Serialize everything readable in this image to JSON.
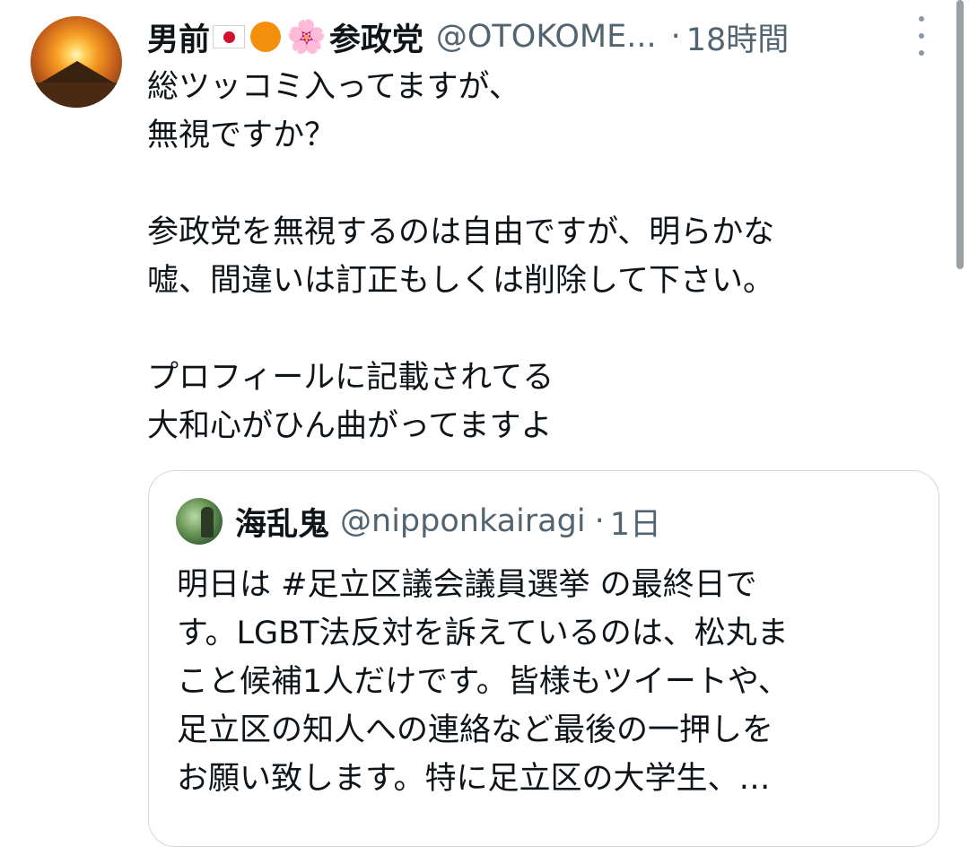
{
  "tweet": {
    "display_name": "男前",
    "name_suffix": "参政党",
    "handle": "@OTOKOME...",
    "separator": "·",
    "time": "18時間",
    "emoji": {
      "flag": "japan-flag-icon",
      "circle": "orange-circle-icon",
      "flower": "🌸"
    },
    "text": "総ツッコミ入ってますが、\n無視ですか？\n\n参政党を無視するのは自由ですが、明らかな\n嘘、間違いは訂正もしくは削除して下さい。\n\nプロフィールに記載されてる\n大和心がひん曲がってますよ"
  },
  "quoted": {
    "display_name": "海乱鬼",
    "handle": "@nipponkairagi",
    "separator": "·",
    "time": "1日",
    "text": "明日は #足立区議会議員選挙 の最終日で\nす。LGBT法反対を訴えているのは、松丸ま\nこと候補1人だけです。皆様もツイートや、\n足立区の知人への連絡など最後の一押しを\nお願い致します。特に足立区の大学生、…"
  },
  "colors": {
    "text": "#0f1419",
    "secondary": "#536471",
    "border": "#cfd9de",
    "background": "#ffffff"
  }
}
